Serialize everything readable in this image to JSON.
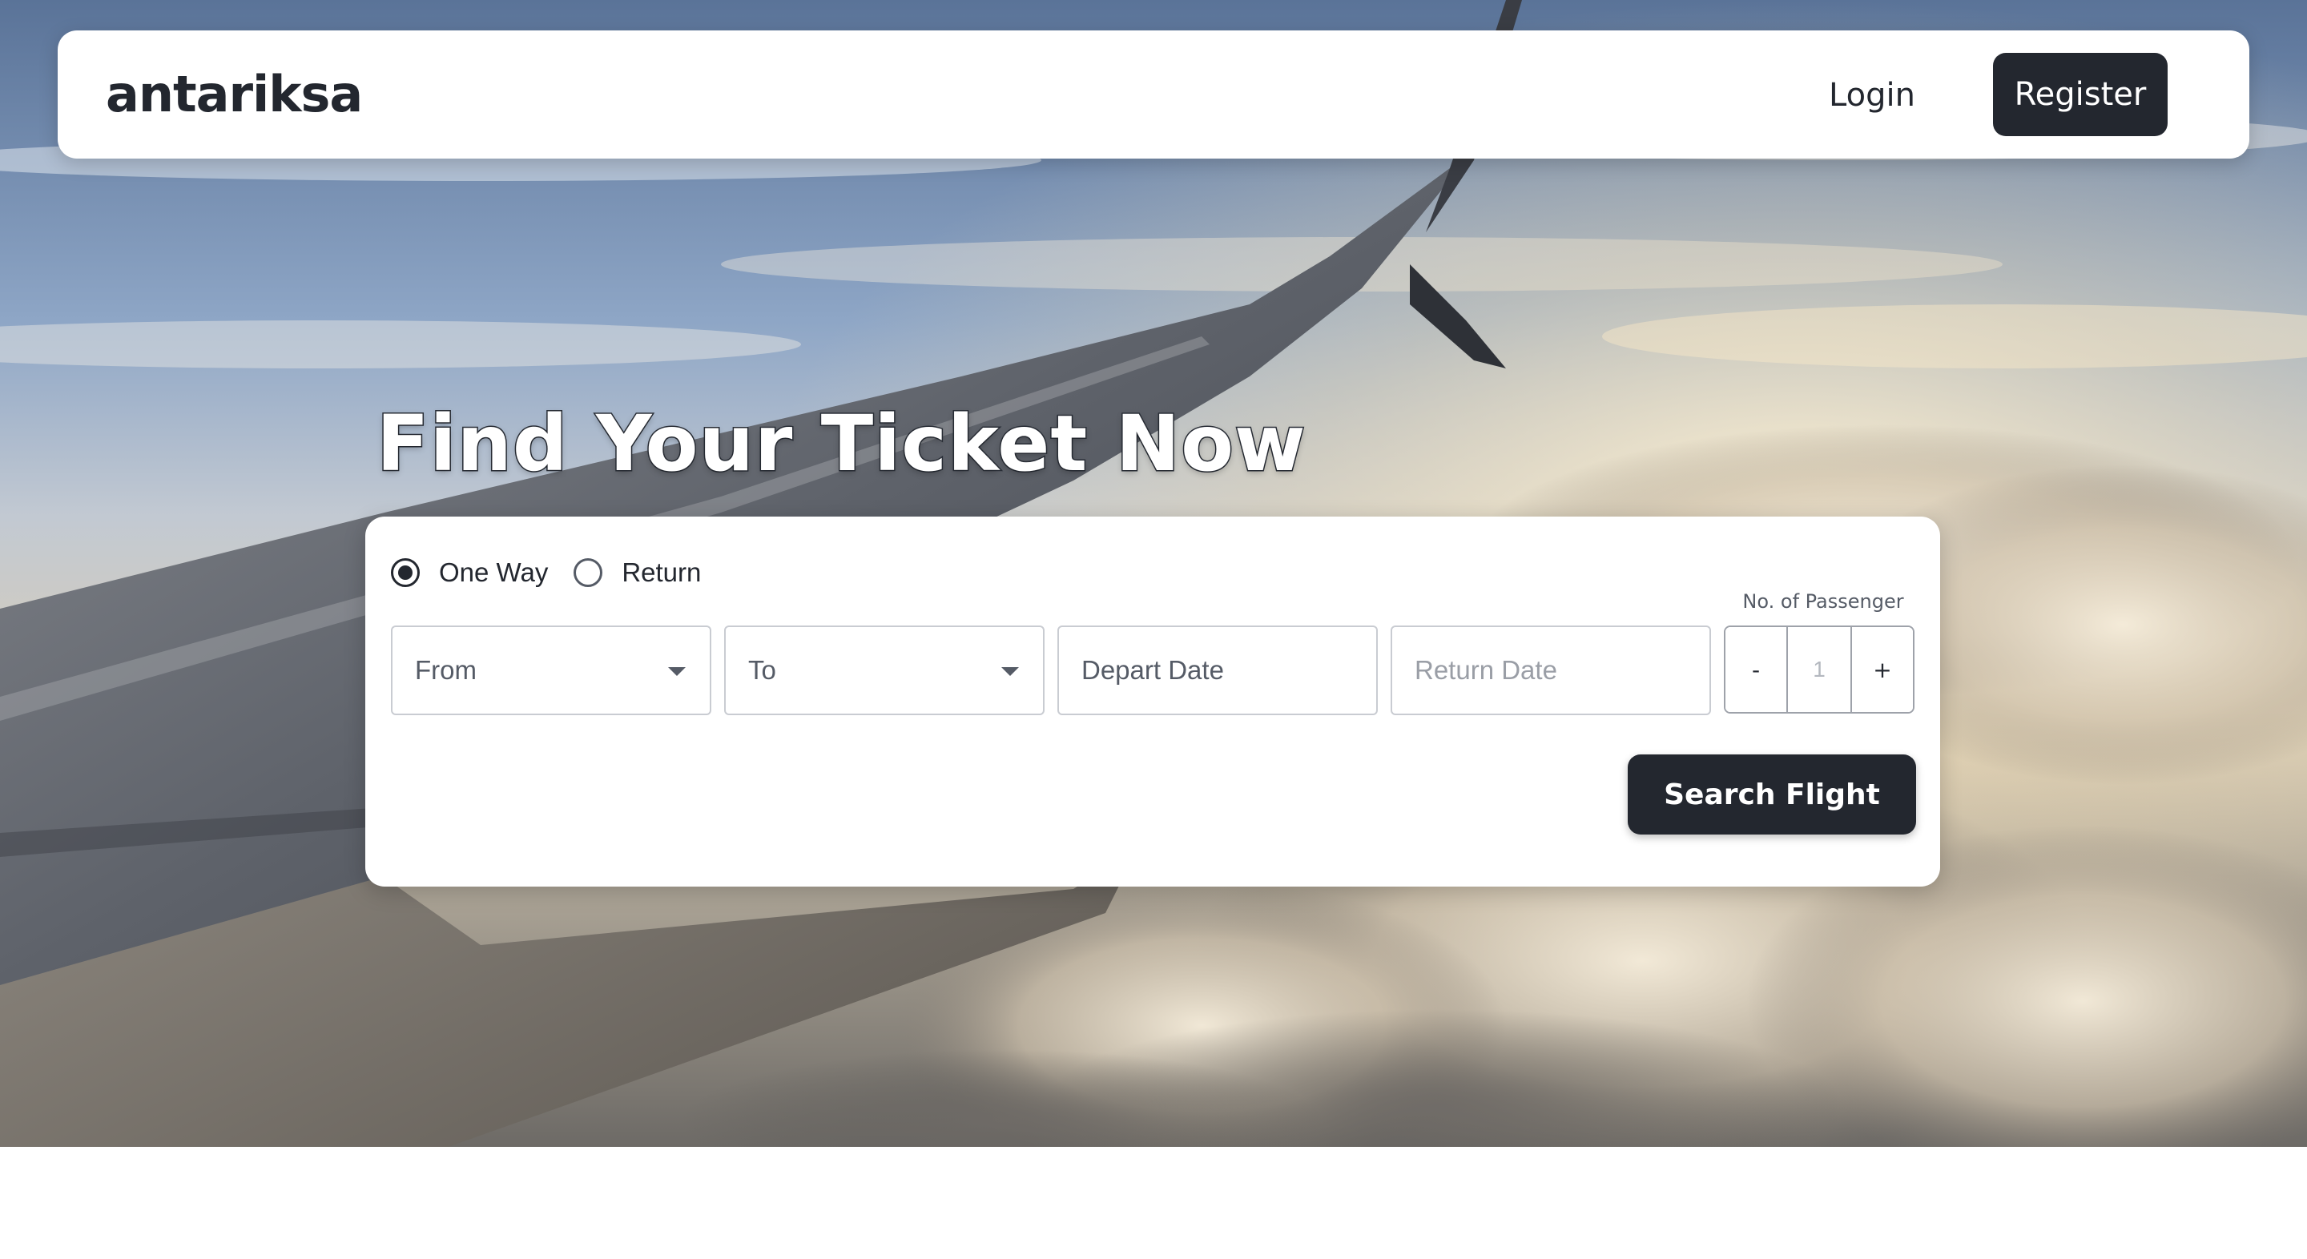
{
  "navbar": {
    "brand": "antariksa",
    "login_label": "Login",
    "register_label": "Register"
  },
  "hero": {
    "headline": "Find Your Ticket Now"
  },
  "search": {
    "trip_types": [
      {
        "label": "One Way",
        "selected": true
      },
      {
        "label": "Return",
        "selected": false
      }
    ],
    "from_placeholder": "From",
    "to_placeholder": "To",
    "depart_placeholder": "Depart Date",
    "return_placeholder": "Return Date",
    "passenger_label": "No. of Passenger",
    "passenger_count": "1",
    "decrement_label": "-",
    "increment_label": "+",
    "submit_label": "Search Flight"
  },
  "colors": {
    "primary_dark": "#23272f",
    "surface": "#ffffff",
    "field_border": "#c9ccd2"
  },
  "icons": {
    "dropdown": "chevron-down-icon",
    "radio_selected": "radio-checked-icon",
    "radio_unselected": "radio-unchecked-icon"
  }
}
